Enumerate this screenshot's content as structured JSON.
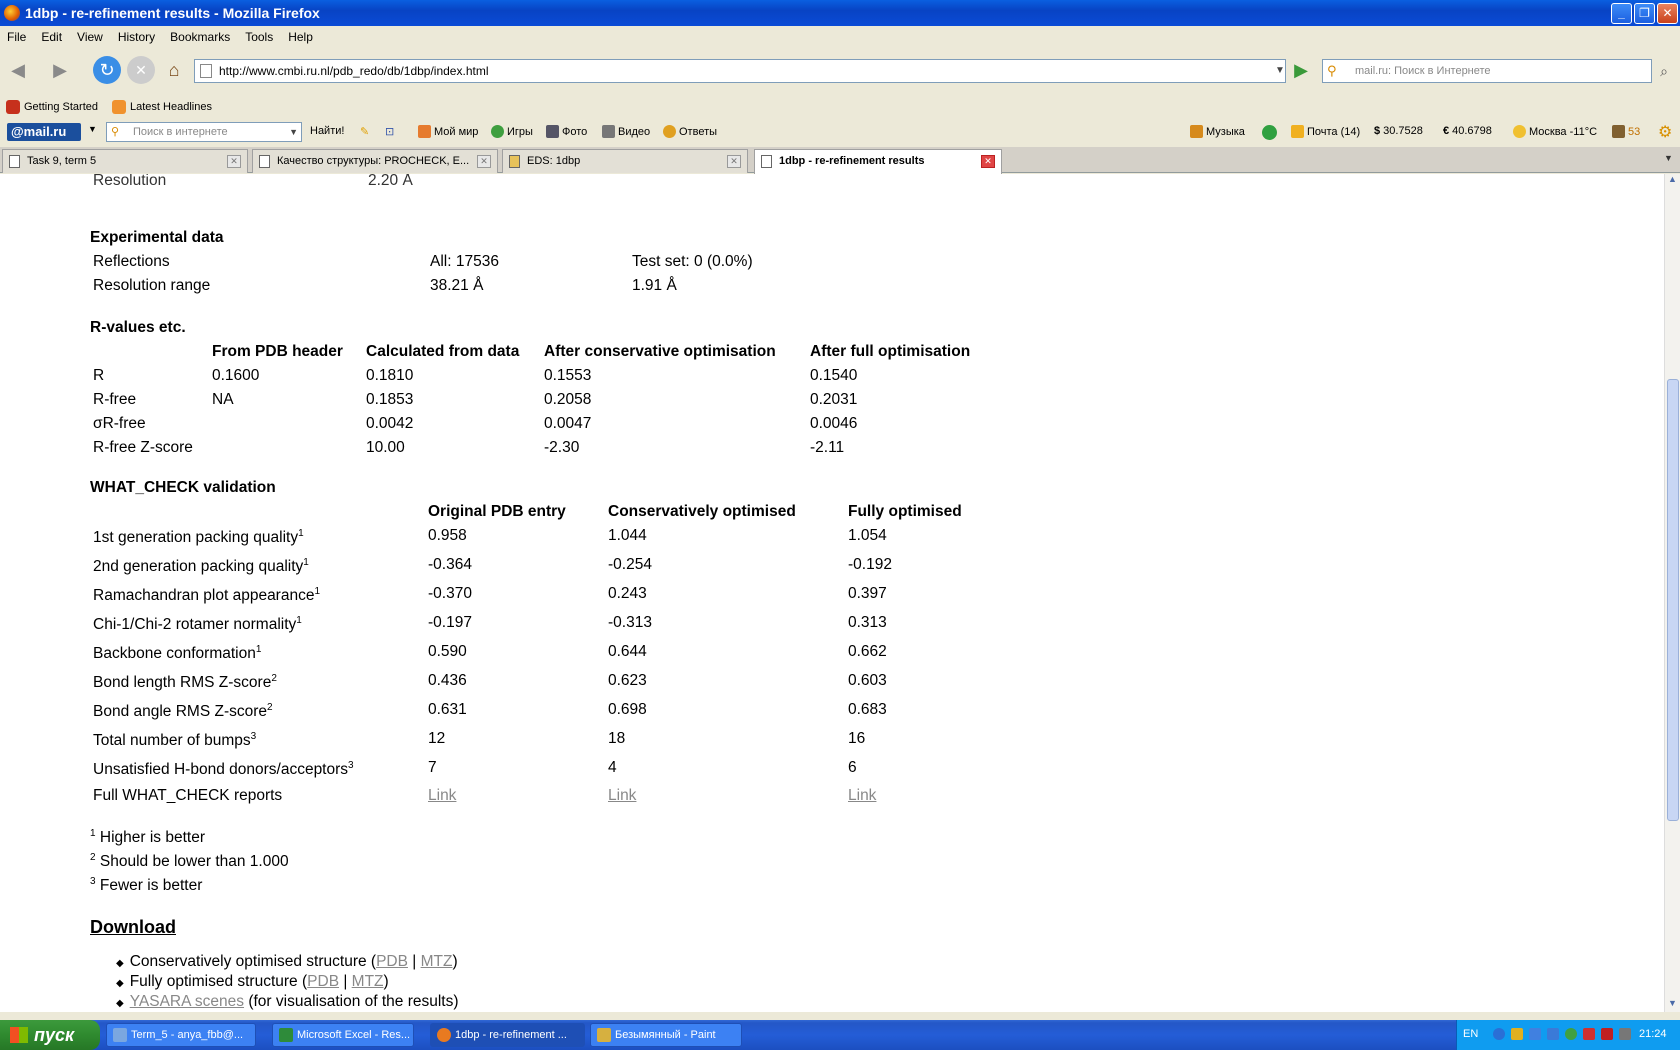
{
  "window": {
    "title": "1dbp - re-refinement results - Mozilla Firefox"
  },
  "menu": [
    "File",
    "Edit",
    "View",
    "History",
    "Bookmarks",
    "Tools",
    "Help"
  ],
  "nav": {
    "url": "http://www.cmbi.ru.nl/pdb_redo/db/1dbp/index.html",
    "search_placeholder": "mail.ru: Поиск в Интернете"
  },
  "bookmarks": [
    "Getting Started",
    "Latest Headlines"
  ],
  "mailbar": {
    "logo": "@mail.ru",
    "search_placeholder": "Поиск в интернете",
    "find_button": "Найти!",
    "links": [
      "Мой мир",
      "Игры",
      "Фото",
      "Видео",
      "Ответы"
    ],
    "music": "Музыка",
    "mail": "Почта (14)",
    "usd": "30.7528",
    "eur": "40.6798",
    "weather": "Москва -11°C",
    "count": "53"
  },
  "tabs": [
    {
      "label": "Task 9, term 5",
      "active": false
    },
    {
      "label": "Качество структуры: PROCHECK, E...",
      "active": false
    },
    {
      "label": "EDS: 1dbp",
      "active": false
    },
    {
      "label": "1dbp - re-refinement results",
      "active": true
    }
  ],
  "page": {
    "partial_row": {
      "label": "Resolution",
      "value": "2.20 Å"
    },
    "experimental": {
      "title": "Experimental data",
      "rows": [
        {
          "label": "Reflections",
          "v1": "All: 17536",
          "v2": "Test set: 0 (0.0%)"
        },
        {
          "label": "Resolution range",
          "v1": "38.21 Å",
          "v2": "1.91 Å"
        }
      ]
    },
    "rvalues": {
      "title": "R-values etc.",
      "headers": [
        "From PDB header",
        "Calculated from data",
        "After conservative optimisation",
        "After full optimisation"
      ],
      "rows": [
        {
          "label": "R",
          "values": [
            "0.1600",
            "0.1810",
            "0.1553",
            "0.1540"
          ]
        },
        {
          "label": "R-free",
          "values": [
            "NA",
            "0.1853",
            "0.2058",
            "0.2031"
          ]
        },
        {
          "label": "σR-free",
          "values": [
            "",
            "0.0042",
            "0.0047",
            "0.0046"
          ]
        },
        {
          "label": "R-free Z-score",
          "values": [
            "",
            "10.00",
            "-2.30",
            "-2.11"
          ]
        }
      ]
    },
    "whatcheck": {
      "title": "WHAT_CHECK validation",
      "headers": [
        "Original PDB entry",
        "Conservatively optimised",
        "Fully optimised"
      ],
      "rows": [
        {
          "label": "1st generation packing quality",
          "sup": "1",
          "values": [
            "0.958",
            "1.044",
            "1.054"
          ]
        },
        {
          "label": "2nd generation packing quality",
          "sup": "1",
          "values": [
            "-0.364",
            "-0.254",
            "-0.192"
          ]
        },
        {
          "label": "Ramachandran plot appearance",
          "sup": "1",
          "values": [
            "-0.370",
            "0.243",
            "0.397"
          ]
        },
        {
          "label": "Chi-1/Chi-2 rotamer normality",
          "sup": "1",
          "values": [
            "-0.197",
            "-0.313",
            "0.313"
          ]
        },
        {
          "label": "Backbone conformation",
          "sup": "1",
          "values": [
            "0.590",
            "0.644",
            "0.662"
          ]
        },
        {
          "label": "Bond length RMS Z-score",
          "sup": "2",
          "values": [
            "0.436",
            "0.623",
            "0.603"
          ]
        },
        {
          "label": "Bond angle RMS Z-score",
          "sup": "2",
          "values": [
            "0.631",
            "0.698",
            "0.683"
          ]
        },
        {
          "label": "Total number of bumps",
          "sup": "3",
          "values": [
            "12",
            "18",
            "16"
          ]
        },
        {
          "label": "Unsatisfied H-bond donors/acceptors",
          "sup": "3",
          "values": [
            "7",
            "4",
            "6"
          ]
        }
      ],
      "reports_label": "Full WHAT_CHECK reports",
      "link_text": "Link"
    },
    "footnotes": [
      {
        "sup": "1",
        "text": "Higher is better"
      },
      {
        "sup": "2",
        "text": "Should be lower than 1.000"
      },
      {
        "sup": "3",
        "text": "Fewer is better"
      }
    ],
    "download": {
      "title": "Download",
      "items": [
        {
          "pre": "Conservatively optimised structure (",
          "links": [
            "PDB",
            "MTZ"
          ],
          "post": ")"
        },
        {
          "pre": "Fully optimised structure (",
          "links": [
            "PDB",
            "MTZ"
          ],
          "post": ")"
        },
        {
          "pre": "",
          "links": [
            "YASARA scenes"
          ],
          "post": " (for visualisation of the results)"
        }
      ]
    }
  },
  "taskbar": {
    "start": "пуск",
    "tasks": [
      {
        "label": "Term_5 - anya_fbb@...",
        "active": false
      },
      {
        "label": "Microsoft Excel - Res...",
        "active": false
      },
      {
        "label": "1dbp - re-refinement ...",
        "active": true
      },
      {
        "label": "Безымянный - Paint",
        "active": false
      }
    ],
    "lang": "EN",
    "clock": "21:24"
  }
}
